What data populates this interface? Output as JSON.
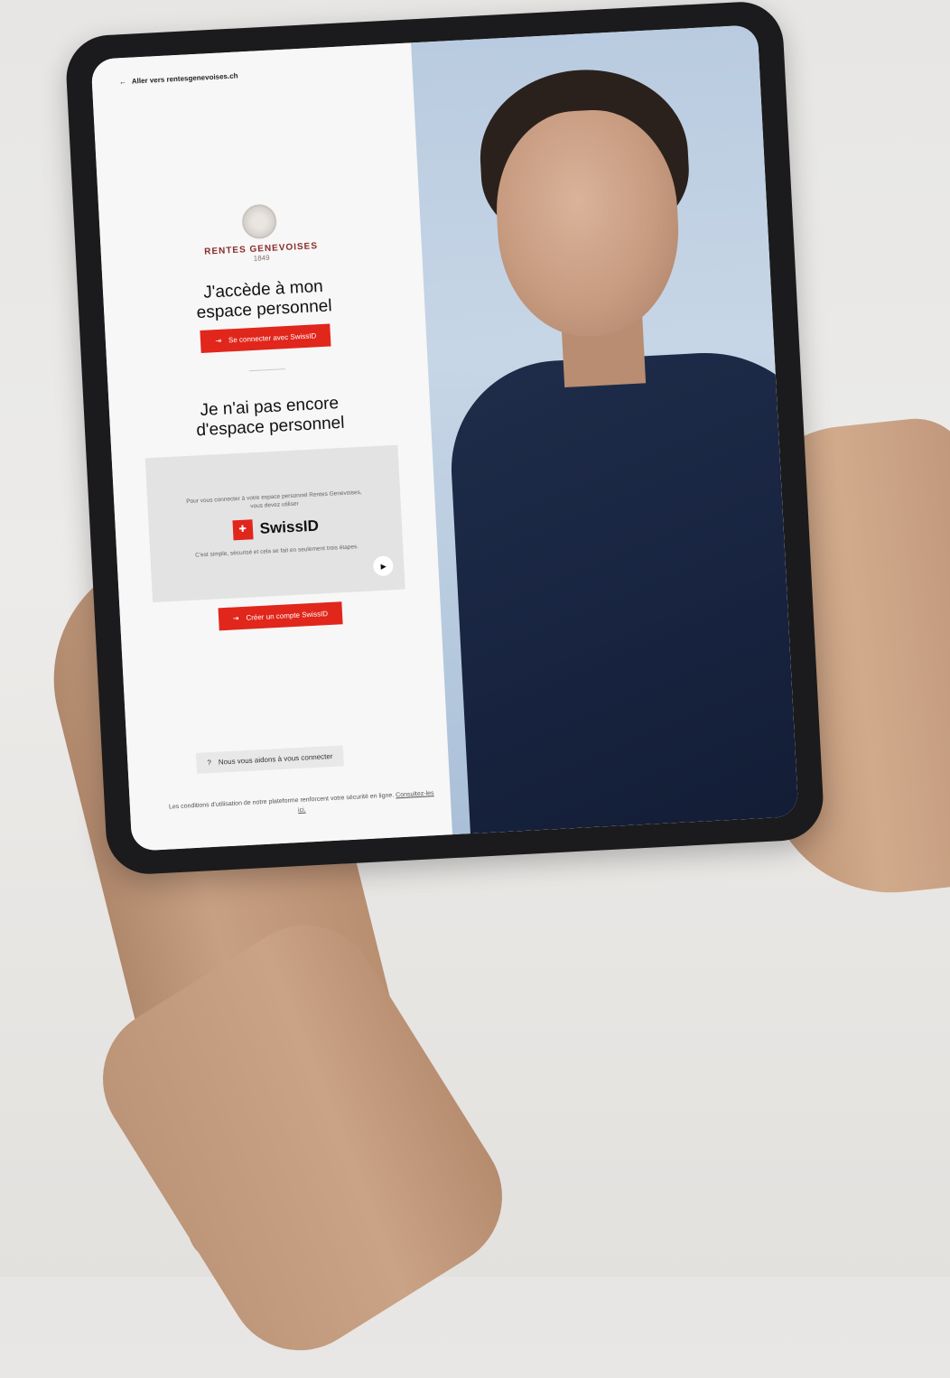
{
  "back_link": {
    "arrow": "←",
    "label": "Aller vers rentesgenevoises.ch"
  },
  "brand": {
    "name": "RENTES GENEVOISES",
    "year": "1849"
  },
  "login": {
    "title_line1": "J'accède à mon",
    "title_line2": "espace personnel",
    "button_label": "Se connecter avec SwissID"
  },
  "signup": {
    "title_line1": "Je n'ai pas encore",
    "title_line2": "d'espace personnel",
    "card_intro": "Pour vous connecter à votre espace personnel Rentes Genevoises, vous devez utiliser",
    "swissid_label": "SwissID",
    "card_note": "C'est simple, sécurisé et cela se fait en seulement trois étapes.",
    "button_label": "Créer un compte SwissID"
  },
  "help": {
    "label": "Nous vous aidons à vous connecter"
  },
  "terms": {
    "text": "Les conditions d'utilisation de notre plateforme renforcent votre sécurité en ligne.",
    "link_label": "Consultez-les ici."
  },
  "colors": {
    "brand_red": "#e1261c",
    "brand_text": "#8a2a2a"
  },
  "icons": [
    "back-arrow-icon",
    "login-arrow-icon",
    "swissid-logo-icon",
    "play-icon",
    "help-icon"
  ]
}
